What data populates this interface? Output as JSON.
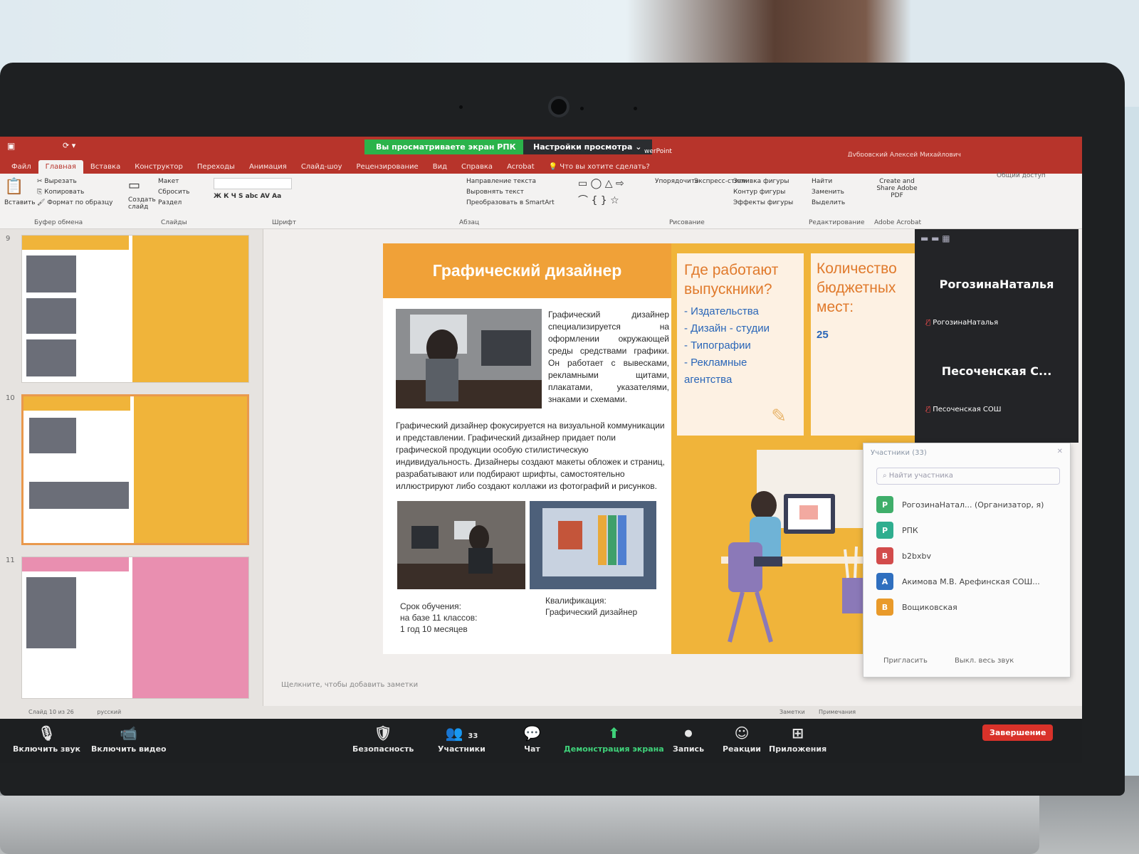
{
  "zoom": {
    "share_badge": "Вы просматриваете экран РПК",
    "view_settings": "Настройки просмотра",
    "mute": "Включить звук",
    "video": "Включить видео",
    "security": "Безопасность",
    "participants": "Участники",
    "participants_count": "33",
    "chat": "Чат",
    "share": "Демонстрация экрана",
    "record": "Запись",
    "reactions": "Реакции",
    "apps": "Приложения",
    "end": "Завершение"
  },
  "ppt": {
    "app_suffix": "werPoint",
    "user": "Дубровский Алексей Михайлович",
    "share_link": "Общий доступ",
    "tabs": [
      "Файл",
      "Главная",
      "Вставка",
      "Конструктор",
      "Переходы",
      "Анимация",
      "Слайд-шоу",
      "Рецензирование",
      "Вид",
      "Справка",
      "Acrobat",
      "Что вы хотите сделать?"
    ],
    "ribbon": {
      "paste": "Вставить",
      "cut": "Вырезать",
      "copy": "Копировать",
      "format_painter": "Формат по образцу",
      "clipboard": "Буфер обмена",
      "new_slide": "Создать слайд",
      "layout": "Макет",
      "reset": "Сбросить",
      "section": "Раздел",
      "slides": "Слайды",
      "font": "Шрифт",
      "text_dir": "Направление текста",
      "align_text": "Выровнять текст",
      "smartart": "Преобразовать в SmartArt",
      "paragraph": "Абзац",
      "arrange": "Упорядочить",
      "quick_styles": "Экспресс-стили",
      "fill": "Заливка фигуры",
      "outline": "Контур фигуры",
      "effects": "Эффекты фигуры",
      "drawing": "Рисование",
      "find": "Найти",
      "replace": "Заменить",
      "select": "Выделить",
      "editing": "Редактирование",
      "create_pdf": "Create and Share Adobe PDF",
      "acrobat": "Adobe Acrobat"
    },
    "thumb_numbers": [
      "9",
      "10",
      "11"
    ],
    "notes_placeholder": "Щелкните, чтобы добавить заметки",
    "status_left": "Слайд 10 из 26",
    "status_lang": "русский",
    "status_notes": "Заметки",
    "status_comments": "Примечания"
  },
  "slide": {
    "title": "Графический дизайнер",
    "intro": "Графический дизайнер специализируется на оформлении окружающей среды средствами графики. Он работает с вывесками, рекламными щитами, плакатами, указателями, знаками и схемами.",
    "body": "Графический дизайнер фокусируется на визуальной коммуникации и представлении. Графический дизайнер придает поли графической продукции особую стилистическую индивидуальность. Дизайнеры создают макеты обложек и страниц, разрабатывают или подбирают шрифты, самостоятельно иллюстрируют либо создают коллажи из фотографий и рисунков.",
    "study_label": "Срок обучения:",
    "study_base": "на базе 11 классов:",
    "study_term": "1 год 10 месяцев",
    "qual_label": "Квалификация:",
    "qual_value": "Графический дизайнер",
    "where_title": "Где работают выпускники?",
    "where_items": [
      "- Издательства",
      "- Дизайн - студии",
      "- Типографии",
      "- Рекламные агентства"
    ],
    "budget_title": "Количество бюджетных мест:",
    "budget_value": "25"
  },
  "gallery": {
    "names": [
      "РогозинаНаталья",
      "Песоченская С..."
    ],
    "subs": [
      "РогозинаНаталья",
      "Песоченская СОШ"
    ]
  },
  "participants_panel": {
    "title": "Участники (33)",
    "search": "Найти участника",
    "rows": [
      {
        "initial": "Р",
        "name": "РогозинаНатал... (Организатор, я)",
        "color": "#3fae6a"
      },
      {
        "initial": "Р",
        "name": "РПК",
        "color": "#2fae8f"
      },
      {
        "initial": "B",
        "name": "b2bxbv",
        "color": "#d24b4b"
      },
      {
        "initial": "А",
        "name": "Акимова М.В. Арефинская СОШ...",
        "color": "#2f6fbf"
      },
      {
        "initial": "В",
        "name": "Вощиковская",
        "color": "#e99a2a"
      }
    ],
    "invite": "Пригласить",
    "mute_all": "Выкл. весь звук"
  }
}
